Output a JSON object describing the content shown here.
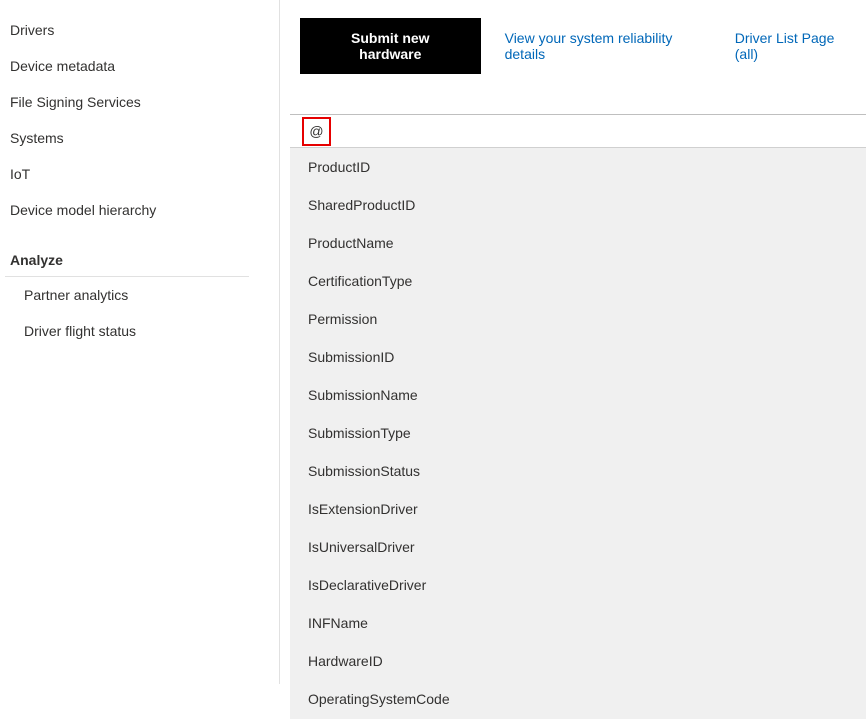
{
  "sidebar": {
    "items": [
      {
        "label": "Drivers"
      },
      {
        "label": "Device metadata"
      },
      {
        "label": "File Signing Services"
      },
      {
        "label": "Systems"
      },
      {
        "label": "IoT"
      },
      {
        "label": "Device model hierarchy"
      }
    ],
    "section_header": "Analyze",
    "subitems": [
      {
        "label": "Partner analytics"
      },
      {
        "label": "Driver flight status"
      }
    ]
  },
  "actions": {
    "submit_button": "Submit new hardware",
    "reliability_link": "View your system reliability details",
    "driver_list_link": "Driver List Page (all)"
  },
  "search": {
    "at_symbol": "@",
    "placeholder": ""
  },
  "dropdown": {
    "items": [
      "ProductID",
      "SharedProductID",
      "ProductName",
      "CertificationType",
      "Permission",
      "SubmissionID",
      "SubmissionName",
      "SubmissionType",
      "SubmissionStatus",
      "IsExtensionDriver",
      "IsUniversalDriver",
      "IsDeclarativeDriver",
      "INFName",
      "HardwareID",
      "OperatingSystemCode"
    ]
  }
}
